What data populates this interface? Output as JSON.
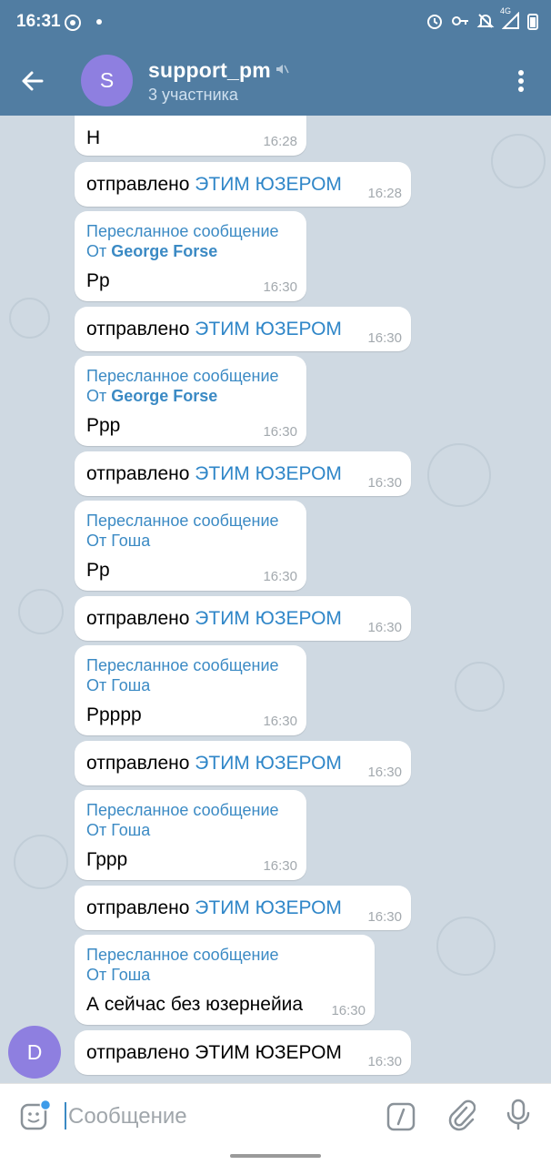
{
  "status_bar": {
    "time": "16:31",
    "network": "4G"
  },
  "header": {
    "avatar_letter": "S",
    "title": "support_pm",
    "subtitle": "3 участника"
  },
  "messages": [
    {
      "type": "text",
      "text": "Н",
      "time": "16:28"
    },
    {
      "type": "sent_by",
      "prefix": "отправлено ",
      "highlight": "ЭТИМ ЮЗЕРОМ",
      "time": "16:28"
    },
    {
      "type": "forwarded",
      "header": "Пересланное сообщение",
      "from_prefix": "От ",
      "from_name": "George Forse",
      "text": "Рр",
      "time": "16:30"
    },
    {
      "type": "sent_by",
      "prefix": "отправлено ",
      "highlight": "ЭТИМ ЮЗЕРОМ",
      "time": "16:30"
    },
    {
      "type": "forwarded",
      "header": "Пересланное сообщение",
      "from_prefix": "От ",
      "from_name": "George Forse",
      "text": "Ррр",
      "time": "16:30"
    },
    {
      "type": "sent_by",
      "prefix": "отправлено ",
      "highlight": "ЭТИМ ЮЗЕРОМ",
      "time": "16:30"
    },
    {
      "type": "forwarded",
      "header": "Пересланное сообщение",
      "from_prefix": "От ",
      "from_name": "Гоша",
      "text": "Рр",
      "time": "16:30"
    },
    {
      "type": "sent_by",
      "prefix": "отправлено ",
      "highlight": "ЭТИМ ЮЗЕРОМ",
      "time": "16:30"
    },
    {
      "type": "forwarded",
      "header": "Пересланное сообщение",
      "from_prefix": "От ",
      "from_name": "Гоша",
      "text": "Ррррр",
      "time": "16:30"
    },
    {
      "type": "sent_by",
      "prefix": "отправлено ",
      "highlight": "ЭТИМ ЮЗЕРОМ",
      "time": "16:30"
    },
    {
      "type": "forwarded",
      "header": "Пересланное сообщение",
      "from_prefix": "От ",
      "from_name": "Гоша",
      "text": "Грpp",
      "time": "16:30"
    },
    {
      "type": "sent_by",
      "prefix": "отправлено ",
      "highlight": "ЭТИМ ЮЗЕРОМ",
      "time": "16:30"
    },
    {
      "type": "forwarded",
      "header": "Пересланное сообщение",
      "from_prefix": "От ",
      "from_name": "Гоша",
      "text": "А сейчас без юзернейиа",
      "time": "16:30"
    },
    {
      "type": "text",
      "text": "отправлено ЭТИМ ЮЗЕРОМ",
      "time": "16:30"
    }
  ],
  "sender_avatar_letter": "D",
  "composer": {
    "placeholder": "Сообщение"
  },
  "colors": {
    "header": "#517da2",
    "accent_link": "#2f86c8",
    "forward_header": "#3b8ac4",
    "avatar": "#8e7fe0",
    "chat_bg": "#cfd9e2"
  },
  "icons": [
    "back-arrow-icon",
    "mute-icon",
    "more-vert-icon",
    "sticker-icon",
    "bot-command-icon",
    "attach-icon",
    "mic-icon"
  ]
}
